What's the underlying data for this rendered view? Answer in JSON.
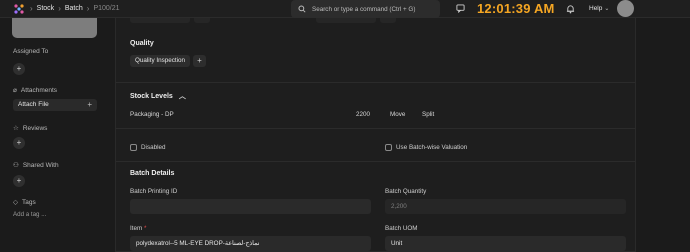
{
  "navbar": {
    "breadcrumbs": [
      "Stock",
      "Batch",
      "P100/21"
    ],
    "search_placeholder": "Search or type a command (Ctrl + G)",
    "clock": "12:01:39 AM",
    "help_label": "Help"
  },
  "sidebar": {
    "assigned_to": "Assigned To",
    "attachments": "Attachments",
    "attach_file": "Attach File",
    "reviews": "Reviews",
    "shared_with": "Shared With",
    "tags": "Tags",
    "add_tag": "Add a tag ..."
  },
  "quality": {
    "title": "Quality",
    "inspection_button": "Quality Inspection"
  },
  "stock_levels": {
    "title": "Stock Levels",
    "warehouse": "Packaging - DP",
    "qty": "2200",
    "move_label": "Move",
    "split_label": "Split"
  },
  "checkboxes": {
    "disabled": "Disabled",
    "batch_valuation": "Use Batch-wise Valuation"
  },
  "batch_details": {
    "title": "Batch Details",
    "printing_id_label": "Batch Printing ID",
    "printing_id_value": "",
    "quantity_label": "Batch Quantity",
    "quantity_value": "2,200",
    "item_label": "Item",
    "item_value": "polydexatrol--5 ML-EYE DROP-نماذج-لصناعة",
    "uom_label": "Batch UOM",
    "uom_value": "Unit"
  },
  "colors": {
    "clock": "#f5a623",
    "background": "#1b1b1b",
    "required": "#e24c4c"
  }
}
